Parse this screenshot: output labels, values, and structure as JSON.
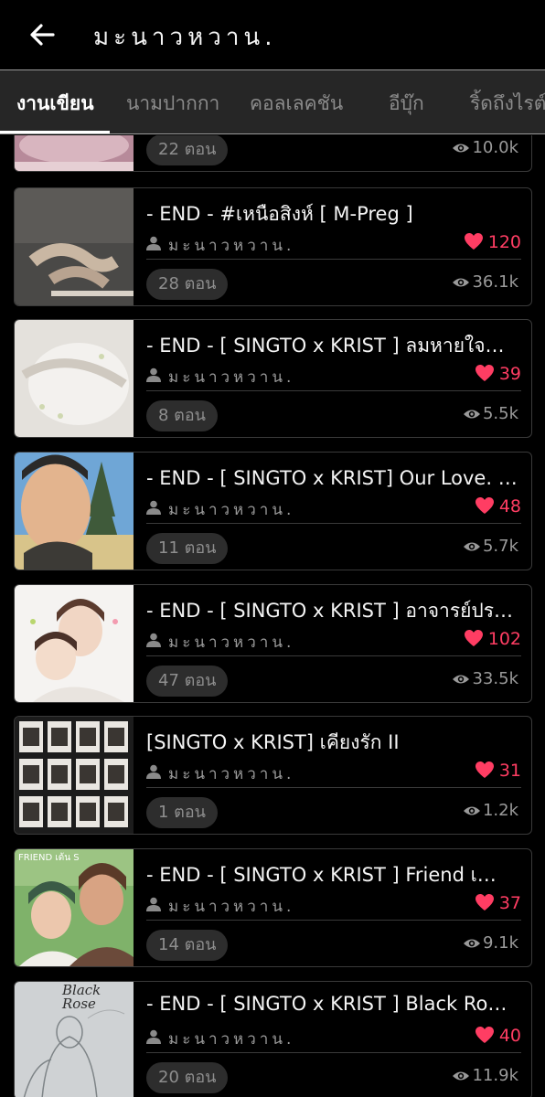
{
  "header": {
    "title": "มะนาวหวาน.",
    "back_icon": "arrow-left-icon"
  },
  "tabs": [
    {
      "label": "งานเขียน",
      "active": true
    },
    {
      "label": "นามปากกา",
      "active": false
    },
    {
      "label": "คอลเลคชัน",
      "active": false
    },
    {
      "label": "อีบุ๊ก",
      "active": false
    },
    {
      "label": "ริ้ดถึงไรต์",
      "active": false
    }
  ],
  "colors": {
    "like": "#ff3d63",
    "background": "#000000",
    "tabbar": "#262626",
    "muted": "#9a9a9a"
  },
  "stories": [
    {
      "title": "",
      "author": "",
      "likes": "",
      "chapters": "22 ตอน",
      "views": "10.0k"
    },
    {
      "title": "- END -  #เหนือสิงห์ [ M-Preg ]",
      "author": "มะนาวหวาน.",
      "likes": "120",
      "chapters": "28 ตอน",
      "views": "36.1k"
    },
    {
      "title": "- END -  [ SINGTO x KRIST ]  ลมหายใจ…",
      "author": "มะนาวหวาน.",
      "likes": "39",
      "chapters": "8 ตอน",
      "views": "5.5k"
    },
    {
      "title": "- END - [ SINGTO x KRIST] Our Love. น้อ…",
      "author": "มะนาวหวาน.",
      "likes": "48",
      "chapters": "11 ตอน",
      "views": "5.7k"
    },
    {
      "title": "- END - [ SINGTO x KRIST ]  อาจารย์ปราช…",
      "author": "มะนาวหวาน.",
      "likes": "102",
      "chapters": "47 ตอน",
      "views": "33.5k"
    },
    {
      "title": "[SINGTO x KRIST]  เคียงรัก II",
      "author": "มะนาวหวาน.",
      "likes": "31",
      "chapters": "1 ตอน",
      "views": "1.2k"
    },
    {
      "title": "-  END  -  [ SINGTO x KRIST ] Friend  เ…",
      "author": "มะนาวหวาน.",
      "likes": "37",
      "chapters": "14 ตอน",
      "views": "9.1k"
    },
    {
      "title": "- END -  [ SINGTO x KRIST ]  Black  Ro…",
      "author": "มะนาวหวาน.",
      "likes": "40",
      "chapters": "20 ตอน",
      "views": "11.9k"
    }
  ],
  "cover_captions": {
    "card7": "FRIEND เด้น S",
    "card8": "Black Rose"
  }
}
